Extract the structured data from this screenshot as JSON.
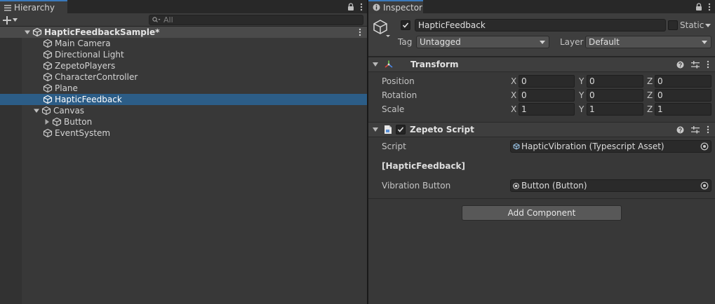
{
  "hierarchy": {
    "tab_label": "Hierarchy",
    "search_placeholder": "All",
    "scene_name": "HapticFeedbackSample*",
    "items": [
      {
        "label": "Main Camera"
      },
      {
        "label": "Directional Light"
      },
      {
        "label": "ZepetoPlayers"
      },
      {
        "label": "CharacterController"
      },
      {
        "label": "Plane"
      },
      {
        "label": "HapticFeedback"
      },
      {
        "label": "Canvas"
      },
      {
        "label": "Button"
      },
      {
        "label": "EventSystem"
      }
    ]
  },
  "inspector": {
    "tab_label": "Inspector",
    "object_name": "HapticFeedback",
    "static_label": "Static",
    "tag_label": "Tag",
    "tag_value": "Untagged",
    "layer_label": "Layer",
    "layer_value": "Default",
    "transform": {
      "title": "Transform",
      "position_label": "Position",
      "rotation_label": "Rotation",
      "scale_label": "Scale",
      "axis_x": "X",
      "axis_y": "Y",
      "axis_z": "Z",
      "position": [
        "0",
        "0",
        "0"
      ],
      "rotation": [
        "0",
        "0",
        "0"
      ],
      "scale": [
        "1",
        "1",
        "1"
      ]
    },
    "zepeto_script": {
      "title": "Zepeto Script",
      "script_label": "Script",
      "script_value": "HapticVibration (Typescript Asset)",
      "section_header": "[HapticFeedback]",
      "vibration_label": "Vibration Button",
      "vibration_value": "Button (Button)"
    },
    "add_component_label": "Add Component"
  },
  "colors": {
    "selection": "#2c5d87",
    "tab_accent": "#3a79bb",
    "panel_bg": "#383838"
  }
}
